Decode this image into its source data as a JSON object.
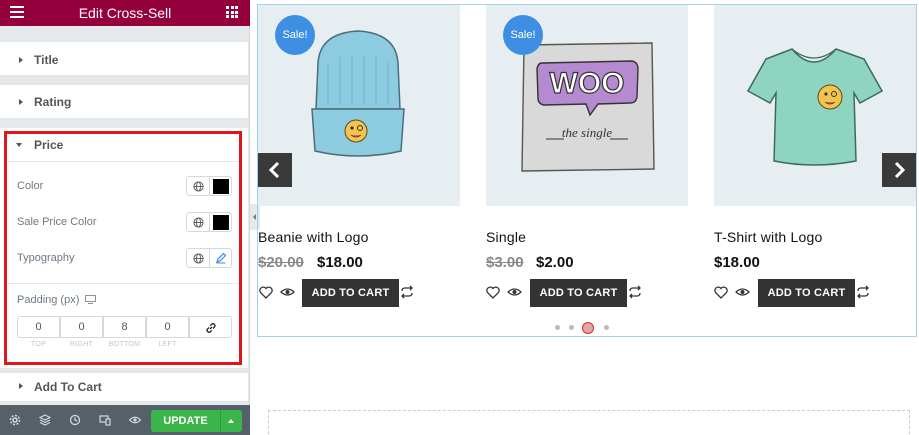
{
  "panel": {
    "title": "Edit Cross-Sell",
    "sections": {
      "title": "Title",
      "rating": "Rating",
      "price": "Price",
      "add_to_cart": "Add To Cart"
    },
    "price_controls": {
      "color_label": "Color",
      "color_value": "#000000",
      "sale_color_label": "Sale Price Color",
      "sale_color_value": "#000000",
      "typography_label": "Typography",
      "padding_label": "Padding (px)",
      "padding_values": [
        "0",
        "0",
        "8",
        "0"
      ],
      "padding_captions": [
        "TOP",
        "RIGHT",
        "BOTTOM",
        "LEFT"
      ]
    },
    "update_label": "UPDATE",
    "bottom_icons": [
      "settings-icon",
      "layers-icon",
      "history-icon",
      "responsive-icon",
      "preview-eye-icon"
    ]
  },
  "colors": {
    "header": "#93003c",
    "update": "#39b54a",
    "highlight": "#e0151b",
    "sale_badge": "#3e8ee4"
  },
  "products": [
    {
      "name": "Beanie with Logo",
      "old_price": "$20.00",
      "price": "$18.00",
      "sale": "Sale!",
      "button": "ADD TO CART"
    },
    {
      "name": "Single",
      "old_price": "$3.00",
      "price": "$2.00",
      "sale": "Sale!",
      "button": "ADD TO CART"
    },
    {
      "name": "T-Shirt with Logo",
      "old_price": "",
      "price": "$18.00",
      "sale": "",
      "button": "ADD TO CART"
    }
  ],
  "carousel": {
    "dots": 4,
    "active_dot": 3
  },
  "woo_poster": {
    "logo": "WOO",
    "caption": "the single"
  }
}
